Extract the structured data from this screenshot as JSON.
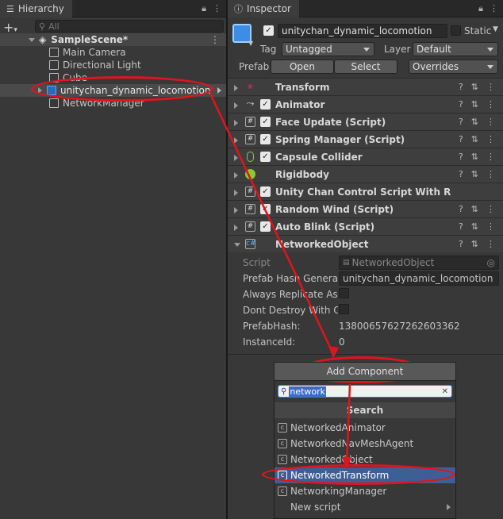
{
  "hierarchy": {
    "tab_label": "Hierarchy",
    "search_placeholder": "All",
    "scene": "SampleScene*",
    "items": [
      {
        "label": "Main Camera"
      },
      {
        "label": "Directional Light"
      },
      {
        "label": "Cube"
      },
      {
        "label": "unitychan_dynamic_locomotion"
      },
      {
        "label": "NetworkManager"
      }
    ]
  },
  "inspector": {
    "tab_label": "Inspector",
    "object_name": "unitychan_dynamic_locomotion",
    "static_label": "Static",
    "tag_label": "Tag",
    "tag_value": "Untagged",
    "layer_label": "Layer",
    "layer_value": "Default",
    "prefab_label": "Prefab",
    "open_label": "Open",
    "select_label": "Select",
    "overrides_label": "Overrides",
    "components": [
      {
        "name": "Transform",
        "icon": "transform-icon",
        "checkbox": false
      },
      {
        "name": "Animator",
        "icon": "animator-icon",
        "checkbox": true
      },
      {
        "name": "Face Update (Script)",
        "icon": "script-icon",
        "checkbox": true
      },
      {
        "name": "Spring Manager (Script)",
        "icon": "script-icon",
        "checkbox": true
      },
      {
        "name": "Capsule Collider",
        "icon": "capsule-collider-icon",
        "checkbox": true
      },
      {
        "name": "Rigidbody",
        "icon": "rigidbody-icon",
        "checkbox": false
      },
      {
        "name": "Unity Chan Control Script With Rgid Bo",
        "icon": "script-icon",
        "checkbox": true
      },
      {
        "name": "Random Wind (Script)",
        "icon": "script-icon",
        "checkbox": true
      },
      {
        "name": "Auto Blink (Script)",
        "icon": "script-icon",
        "checkbox": true
      },
      {
        "name": "NetworkedObject",
        "icon": "networked-icon",
        "checkbox": false
      }
    ],
    "networked_fields": [
      {
        "label": "Script",
        "value": "NetworkedObject"
      },
      {
        "label": "Prefab Hash Generato",
        "value": "unitychan_dynamic_locomotion"
      },
      {
        "label": "Always Replicate As",
        "value": ""
      },
      {
        "label": "Dont Destroy With Ow",
        "value": ""
      },
      {
        "label": "PrefabHash:",
        "value": "13800657627262603362"
      },
      {
        "label": "InstanceId:",
        "value": "0"
      }
    ],
    "add_component_label": "Add Component"
  },
  "popup": {
    "search_value": "network",
    "header": "Search",
    "items": [
      {
        "label": "NetworkedAnimator"
      },
      {
        "label": "NetworkedNavMeshAgent"
      },
      {
        "label": "NetworkedObject"
      },
      {
        "label": "NetworkedTransform"
      },
      {
        "label": "NetworkingManager"
      },
      {
        "label": "New script"
      }
    ]
  },
  "colors": {
    "panel": "#383838",
    "selected": "#2c5d87",
    "highlight_item": "#3e5f96",
    "annotation": "#e0141e"
  }
}
